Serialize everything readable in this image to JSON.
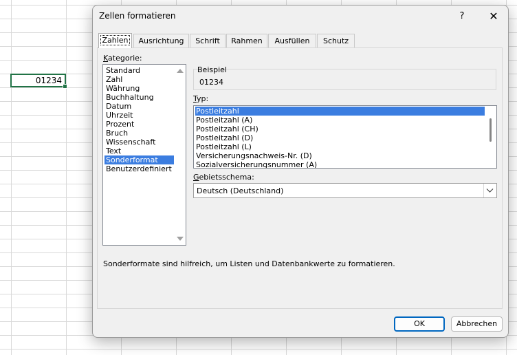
{
  "sheet": {
    "active_cell_value": "01234"
  },
  "dialog": {
    "title": "Zellen formatieren",
    "help_label": "?",
    "close_label": "✕"
  },
  "tabs": [
    {
      "label": "Zahlen",
      "active": true
    },
    {
      "label": "Ausrichtung",
      "active": false
    },
    {
      "label": "Schrift",
      "active": false
    },
    {
      "label": "Rahmen",
      "active": false
    },
    {
      "label": "Ausfüllen",
      "active": false
    },
    {
      "label": "Schutz",
      "active": false
    }
  ],
  "category": {
    "label_first": "K",
    "label_rest": "ategorie:",
    "items": [
      "Standard",
      "Zahl",
      "Währung",
      "Buchhaltung",
      "Datum",
      "Uhrzeit",
      "Prozent",
      "Bruch",
      "Wissenschaft",
      "Text",
      "Sonderformat",
      "Benutzerdefiniert"
    ],
    "selected": "Sonderformat"
  },
  "sample": {
    "label": "Beispiel",
    "value": "01234"
  },
  "type": {
    "label_first": "T",
    "label_rest": "yp:",
    "items": [
      "Postleitzahl",
      "Postleitzahl (A)",
      "Postleitzahl (CH)",
      "Postleitzahl (D)",
      "Postleitzahl (L)",
      "Versicherungsnachweis-Nr. (D)",
      "Sozialversicherungsnummer (A)"
    ],
    "selected": "Postleitzahl"
  },
  "locale": {
    "label_first": "G",
    "label_rest": "ebietsschema:",
    "value": "Deutsch (Deutschland)"
  },
  "description": "Sonderformate sind hilfreich, um Listen und Datenbankwerte zu formatieren.",
  "buttons": {
    "ok": "OK",
    "cancel": "Abbrechen"
  },
  "colors": {
    "selection": "#3b7de0",
    "primary_button_border": "#0067c0",
    "cell_border": "#217346"
  }
}
